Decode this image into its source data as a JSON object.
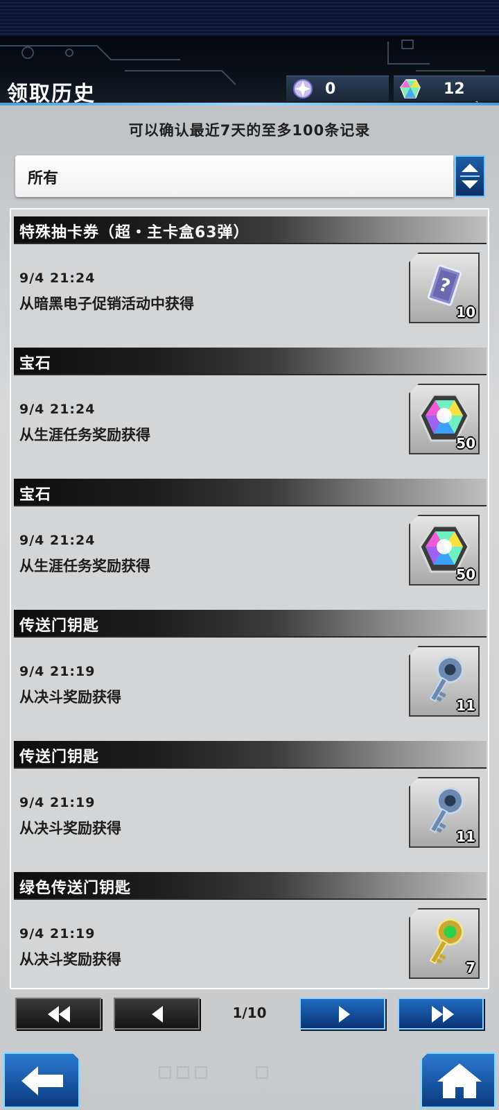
{
  "header": {
    "title": "领取历史",
    "currency_orbs": "0",
    "currency_gems": "12"
  },
  "notice": "可以确认最近7天的至多100条记录",
  "filter": {
    "selected": "所有"
  },
  "entries": [
    {
      "title": "特殊抽卡券（超・主卡盒63弹）",
      "time": "9/4 21:24",
      "source": "从暗黑电子促销活动中获得",
      "quantity": "10",
      "icon": "ticket-icon"
    },
    {
      "title": "宝石",
      "time": "9/4 21:24",
      "source": "从生涯任务奖励获得",
      "quantity": "50",
      "icon": "gem-icon"
    },
    {
      "title": "宝石",
      "time": "9/4 21:24",
      "source": "从生涯任务奖励获得",
      "quantity": "50",
      "icon": "gem-icon"
    },
    {
      "title": "传送门钥匙",
      "time": "9/4 21:19",
      "source": "从决斗奖励获得",
      "quantity": "11",
      "icon": "gate-key-icon"
    },
    {
      "title": "传送门钥匙",
      "time": "9/4 21:19",
      "source": "从决斗奖励获得",
      "quantity": "11",
      "icon": "gate-key-icon"
    },
    {
      "title": "绿色传送门钥匙",
      "time": "9/4 21:19",
      "source": "从决斗奖励获得",
      "quantity": "7",
      "icon": "green-gate-key-icon"
    }
  ],
  "pagination": {
    "indicator": "1/10"
  }
}
